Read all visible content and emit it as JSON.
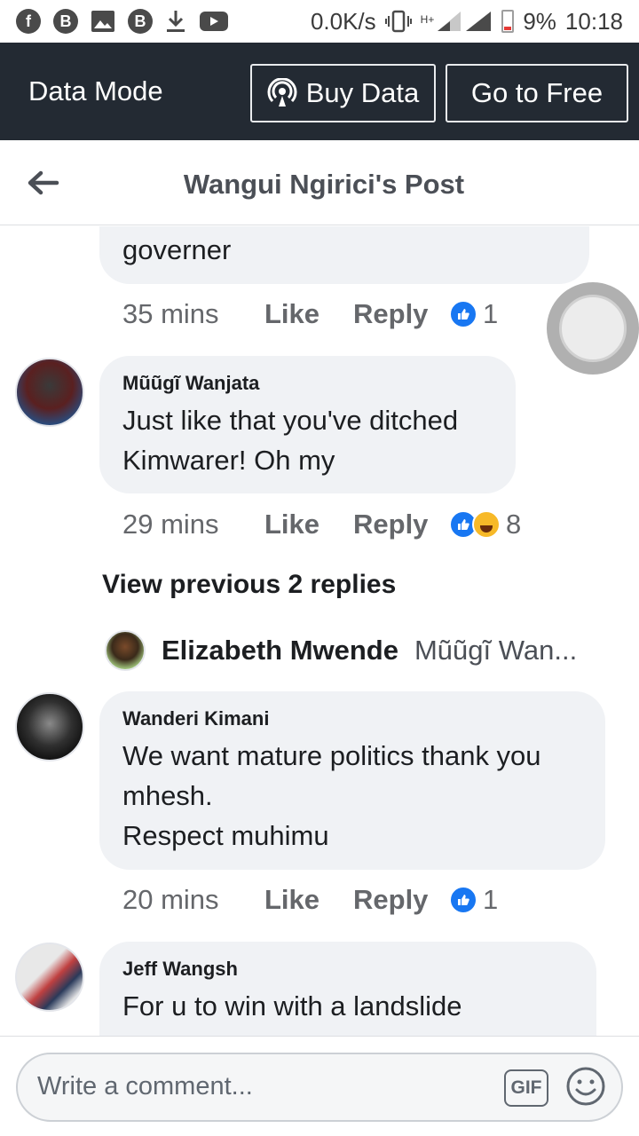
{
  "status_bar": {
    "net_speed": "0.0K/s",
    "network": "H+",
    "battery": "9%",
    "time": "10:18"
  },
  "data_bar": {
    "title": "Data Mode",
    "buy_label": "Buy Data",
    "free_label": "Go to Free"
  },
  "header": {
    "title": "Wangui Ngirici's Post"
  },
  "comments": [
    {
      "text": "governer",
      "time": "35 mins",
      "like_label": "Like",
      "reply_label": "Reply",
      "reaction_count": "1"
    },
    {
      "name": "Mũũgĩ Wanjata",
      "text": "Just like that you've ditched\nKimwarer! Oh my",
      "time": "29 mins",
      "like_label": "Like",
      "reply_label": "Reply",
      "reaction_count": "8"
    },
    {
      "name": "Wanderi Kimani",
      "text": "We want mature politics thank you\nmhesh.\nRespect muhimu",
      "time": "20 mins",
      "like_label": "Like",
      "reply_label": "Reply",
      "reaction_count": "1"
    },
    {
      "name": "Jeff Wangsh",
      "text": "For u to win with a landslide"
    }
  ],
  "replies_block": {
    "view_previous": "View previous 2 replies",
    "reply_name": "Elizabeth Mwende",
    "reply_preview": "Mũũgĩ Wan..."
  },
  "composer": {
    "placeholder": "Write a comment...",
    "gif_label": "GIF"
  }
}
